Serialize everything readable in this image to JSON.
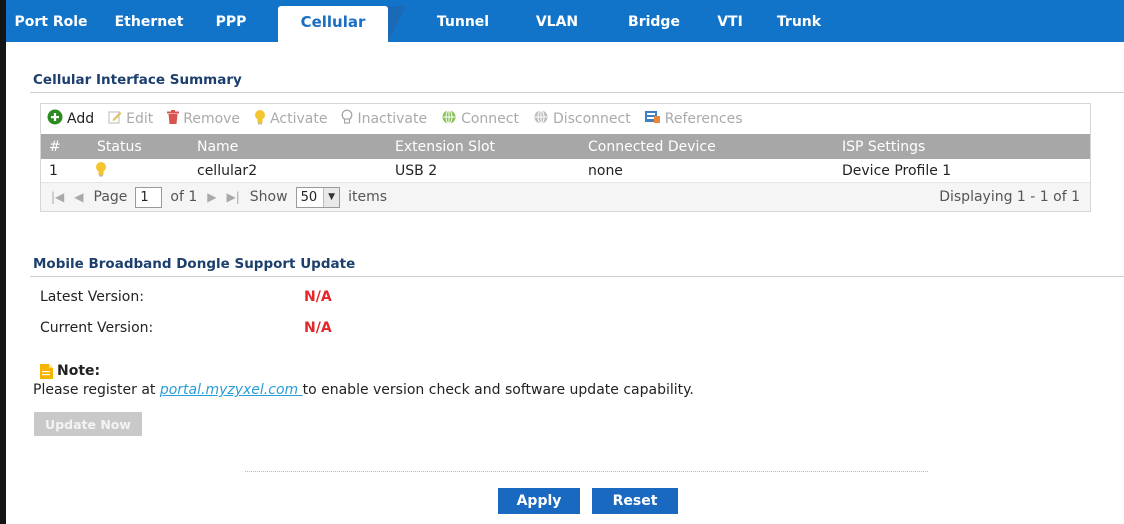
{
  "tabs": [
    {
      "label": "Port Role",
      "active": false
    },
    {
      "label": "Ethernet",
      "active": false
    },
    {
      "label": "PPP",
      "active": false
    },
    {
      "label": "Cellular",
      "active": true
    },
    {
      "label": "Tunnel",
      "active": false
    },
    {
      "label": "VLAN",
      "active": false
    },
    {
      "label": "Bridge",
      "active": false
    },
    {
      "label": "VTI",
      "active": false
    },
    {
      "label": "Trunk",
      "active": false
    }
  ],
  "summary": {
    "title": "Cellular Interface Summary",
    "toolbar": {
      "add": "Add",
      "edit": "Edit",
      "remove": "Remove",
      "activate": "Activate",
      "inactivate": "Inactivate",
      "connect": "Connect",
      "disconnect": "Disconnect",
      "references": "References"
    },
    "columns": [
      "#",
      "Status",
      "Name",
      "Extension Slot",
      "Connected Device",
      "ISP Settings"
    ],
    "rows": [
      {
        "index": "1",
        "status_icon": "lightbulb-on-icon",
        "name": "cellular2",
        "extension_slot": "USB 2",
        "connected_device": "none",
        "isp_settings": "Device Profile 1"
      }
    ],
    "pager": {
      "page_label": "Page",
      "page_value": "1",
      "of_label": "of 1",
      "show_label": "Show",
      "show_value": "50",
      "items_label": "items",
      "displaying": "Displaying 1 - 1 of 1"
    }
  },
  "dongle": {
    "title": "Mobile Broadband Dongle Support Update",
    "latest_label": "Latest Version:",
    "latest_value": "N/A",
    "current_label": "Current Version:",
    "current_value": "N/A",
    "note_title": "Note:",
    "note_before": "Please register at ",
    "note_link": "portal.myzyxel.com ",
    "note_after": "to enable version check and software update capability.",
    "update_button": "Update Now"
  },
  "footer": {
    "apply": "Apply",
    "reset": "Reset"
  },
  "colors": {
    "tab_bar": "#1274c9",
    "value_red": "#e3272a",
    "button_blue": "#1969c0",
    "link": "#2a9dd8"
  }
}
